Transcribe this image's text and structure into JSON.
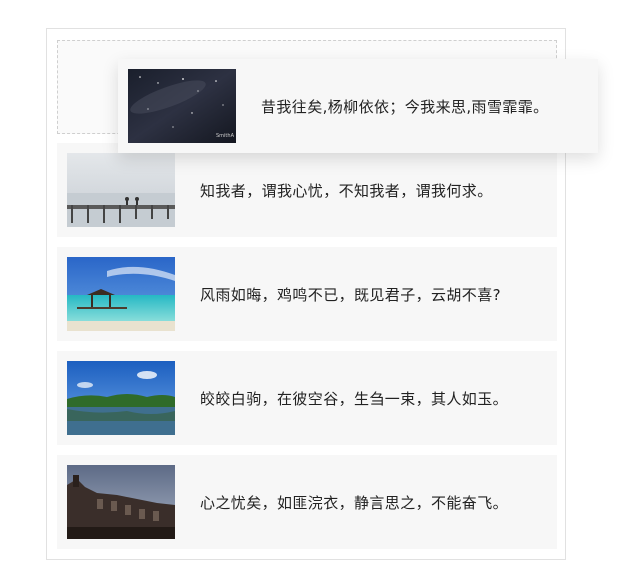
{
  "items": [
    {
      "text": "昔我往矣,杨柳依依；今我来思,雨雪霏霏。",
      "image": "milky-way-night-sky",
      "watermark": "SmithA"
    },
    {
      "text": "知我者，谓我心忧，不知我者，谓我何求。",
      "image": "pier-over-lake"
    },
    {
      "text": "风雨如晦，鸡鸣不已，既见君子，云胡不喜?",
      "image": "beach-pavilion"
    },
    {
      "text": "皎皎白驹，在彼空谷，生刍一束，其人如玉。",
      "image": "lake-reflection"
    },
    {
      "text": "心之忧矣，如匪浣衣，静言思之，不能奋飞。",
      "image": "palace-building"
    }
  ]
}
